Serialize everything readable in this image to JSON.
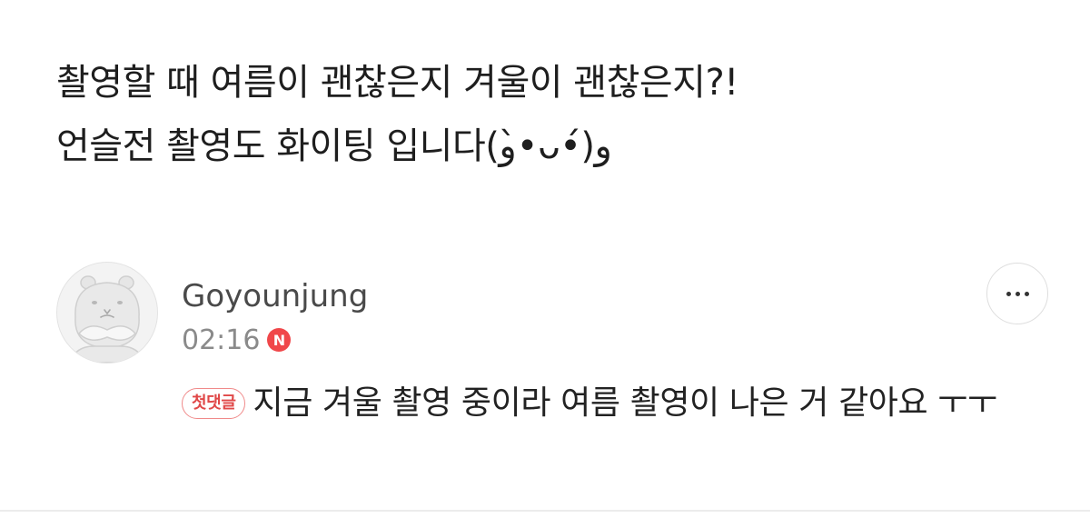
{
  "post": {
    "lines": [
      "촬영할 때 여름이 괜찮은지 겨울이 괜찮은지?!",
      "언슬전 촬영도 화이팅 입니다(و•̀ᴗ•́)و"
    ]
  },
  "comment": {
    "author": "Goyounjung",
    "time": "02:16",
    "new_badge": "N",
    "first_comment_badge": "첫댓글",
    "text": "지금 겨울 촬영 중이라 여름 촬영이 나은 거 같아요 ㅜㅜ",
    "avatar_icon": "hippo-avatar-icon",
    "more_icon": "more-horizontal-icon"
  },
  "colors": {
    "new_badge": "#f0474a",
    "first_badge_border": "#f08a8a",
    "first_badge_text": "#e04848",
    "author": "#4a4a4a",
    "time": "#8a8a8a"
  }
}
